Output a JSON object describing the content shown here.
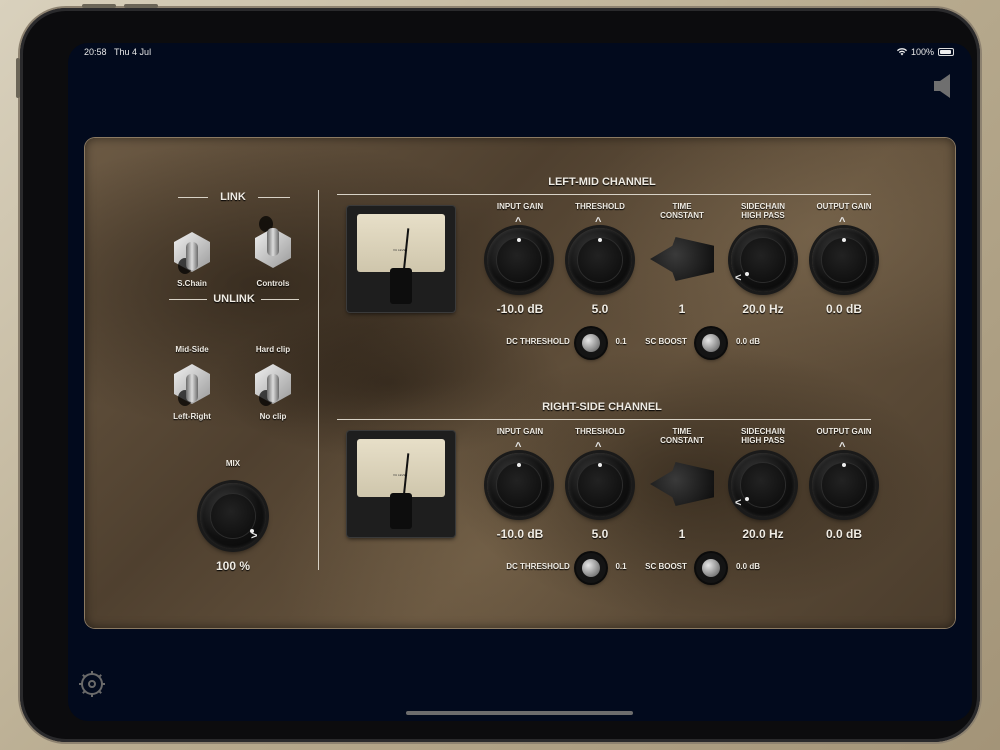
{
  "status_bar": {
    "time": "20:58",
    "date": "Thu 4 Jul",
    "battery": "100%"
  },
  "link_section": {
    "link_title": "LINK",
    "unlink_title": "UNLINK",
    "schain_label": "S.Chain",
    "controls_label": "Controls",
    "mid_side_label": "Mid-Side",
    "left_right_label": "Left-Right",
    "hard_clip_label": "Hard clip",
    "no_clip_label": "No clip",
    "mix_label": "MIX",
    "mix_value": "100 %"
  },
  "channels": [
    {
      "title": "LEFT-MID CHANNEL",
      "input_gain_label": "INPUT GAIN",
      "input_gain_value": "-10.0 dB",
      "threshold_label": "THRESHOLD",
      "threshold_value": "5.0",
      "time_constant_label_1": "TIME",
      "time_constant_label_2": "CONSTANT",
      "time_constant_value": "1",
      "sidechain_label_1": "SIDECHAIN",
      "sidechain_label_2": "HIGH PASS",
      "sidechain_value": "20.0 Hz",
      "output_gain_label": "OUTPUT GAIN",
      "output_gain_value": "0.0 dB",
      "dc_threshold_label": "DC THRESHOLD",
      "dc_threshold_value": "0.1",
      "sc_boost_label": "SC BOOST",
      "sc_boost_value": "0.0 dB"
    },
    {
      "title": "RIGHT-SIDE CHANNEL",
      "input_gain_label": "INPUT GAIN",
      "input_gain_value": "-10.0 dB",
      "threshold_label": "THRESHOLD",
      "threshold_value": "5.0",
      "time_constant_label_1": "TIME",
      "time_constant_label_2": "CONSTANT",
      "time_constant_value": "1",
      "sidechain_label_1": "SIDECHAIN",
      "sidechain_label_2": "HIGH PASS",
      "sidechain_value": "20.0 Hz",
      "output_gain_label": "OUTPUT GAIN",
      "output_gain_value": "0.0 dB",
      "dc_threshold_label": "DC THRESHOLD",
      "dc_threshold_value": "0.1",
      "sc_boost_label": "SC BOOST",
      "sc_boost_value": "0.0 dB"
    }
  ],
  "icons": {
    "speaker": "speaker-icon",
    "settings": "gear-icon",
    "wifi": "wifi-icon",
    "battery": "battery-icon"
  }
}
